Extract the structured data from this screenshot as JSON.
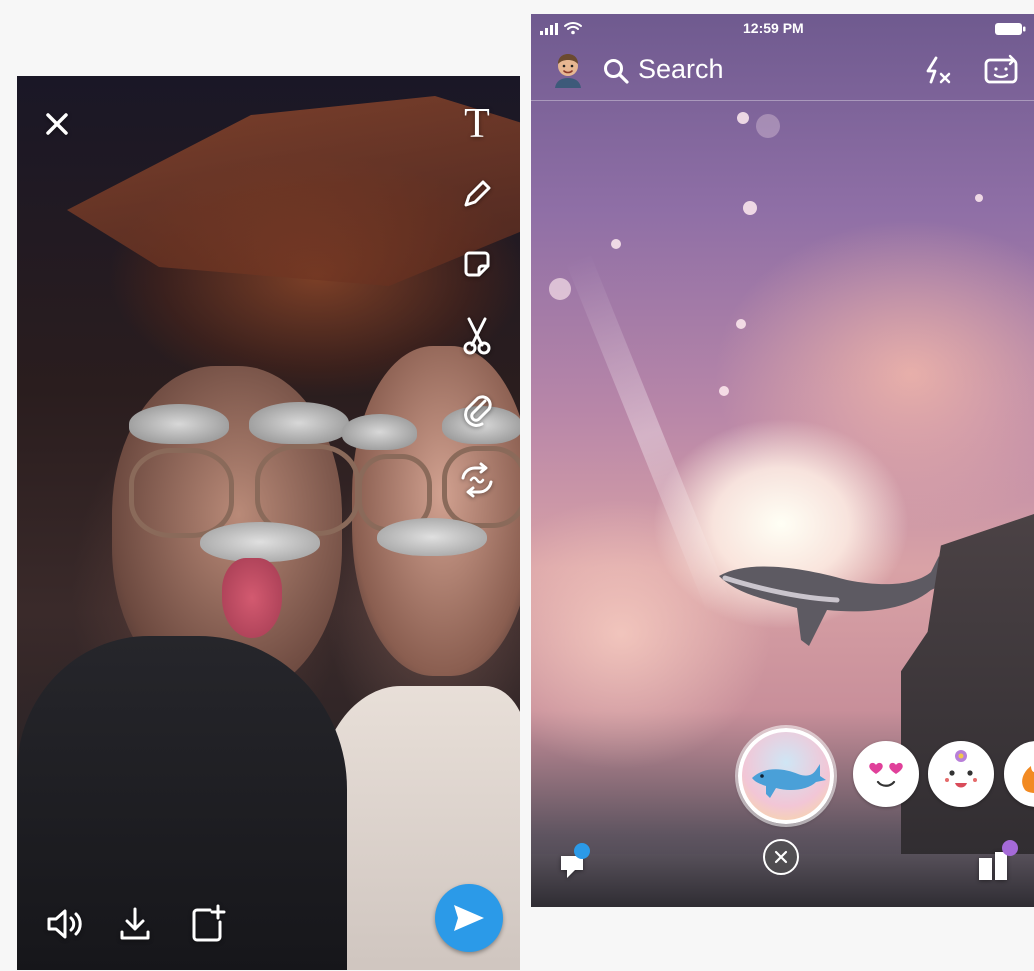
{
  "editor": {
    "tools": {
      "text": "T"
    }
  },
  "camera": {
    "status_bar": {
      "time": "12:59 PM"
    },
    "header": {
      "search_label": "Search"
    },
    "lenses": [
      {
        "name": "whale-lens"
      },
      {
        "name": "heart-eyes-lens"
      },
      {
        "name": "flower-face-lens"
      },
      {
        "name": "fire-lens"
      }
    ]
  },
  "colors": {
    "send_button": "#2b9ae8",
    "notification_dot": "#2b9ae8",
    "discover_dot": "#a56ad8",
    "icon": "#ffffff"
  }
}
